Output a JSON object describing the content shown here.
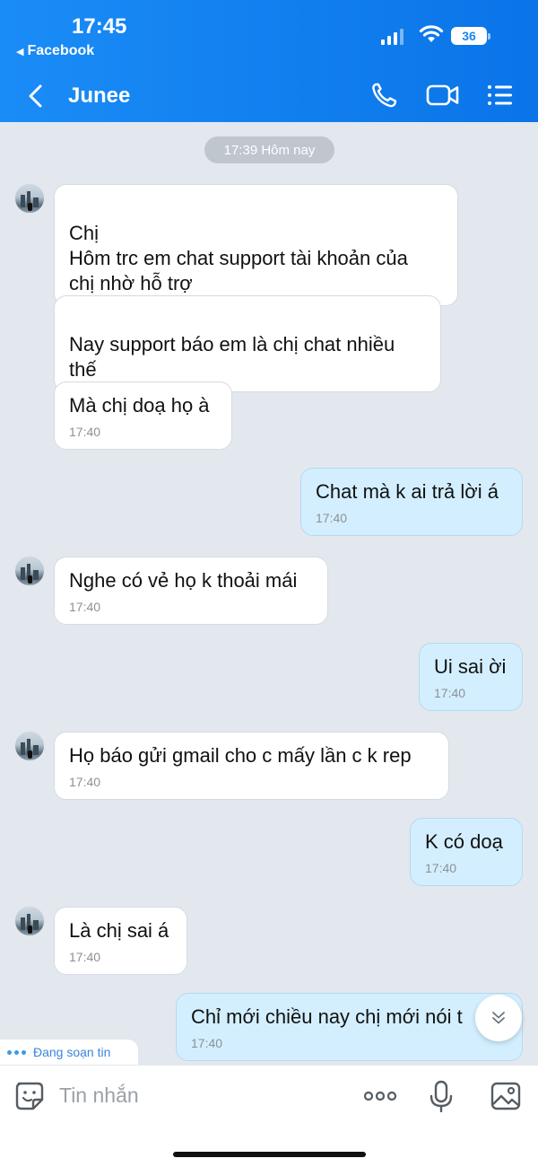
{
  "status_bar": {
    "time": "17:45",
    "back_app": "Facebook",
    "battery": "36"
  },
  "nav": {
    "contact_name": "Junee"
  },
  "date_separator": "17:39 Hôm nay",
  "messages": [
    {
      "text": "Chị\nHôm trc em chat support tài khoản của\nchị nhờ hỗ trợ",
      "time": ""
    },
    {
      "text": "Nay support báo em là chị chat nhiều\nthế",
      "time": ""
    },
    {
      "text": "Mà chị doạ họ à",
      "time": "17:40"
    },
    {
      "text": "Chat mà k ai trả lời á",
      "time": "17:40"
    },
    {
      "text": "Nghe có vẻ họ k thoải mái",
      "time": "17:40"
    },
    {
      "text": "Ui sai ời",
      "time": "17:40"
    },
    {
      "text": "Họ báo gửi gmail cho c mấy lần c k rep",
      "time": "17:40"
    },
    {
      "text": "K có doạ",
      "time": "17:40"
    },
    {
      "text": "Là chị sai á",
      "time": "17:40"
    },
    {
      "text": "Chỉ mới chiều nay chị mới nói t",
      "time": "17:40"
    }
  ],
  "typing_indicator": "Đang soạn tin",
  "input": {
    "placeholder": "Tin nhắn"
  },
  "icons": {
    "nav": [
      "back-icon",
      "phone-icon",
      "video-call-icon",
      "menu-icon"
    ],
    "input": [
      "sticker-icon",
      "more-icon",
      "microphone-icon",
      "image-icon"
    ],
    "scroll": "chevron-double-down-icon"
  },
  "colors": {
    "header": "#0a74e8",
    "incoming_bubble": "#ffffff",
    "outgoing_bubble": "#d3efff",
    "chat_background": "#e3e8ee"
  }
}
